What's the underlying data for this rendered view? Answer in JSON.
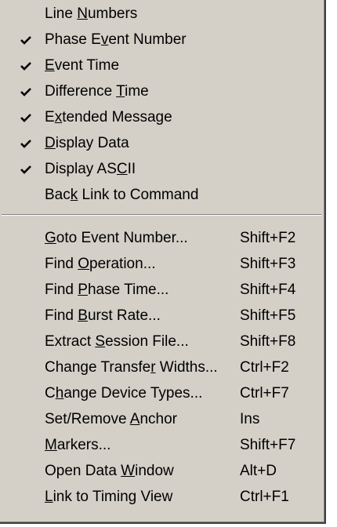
{
  "menu": {
    "view_items": [
      {
        "label_pre": "Line ",
        "accel": "N",
        "label_post": "umbers",
        "checked": false
      },
      {
        "label_pre": "Phase E",
        "accel": "v",
        "label_post": "ent Number",
        "checked": true
      },
      {
        "label_pre": "",
        "accel": "E",
        "label_post": "vent Time",
        "checked": true
      },
      {
        "label_pre": "Difference ",
        "accel": "T",
        "label_post": "ime",
        "checked": true
      },
      {
        "label_pre": "E",
        "accel": "x",
        "label_post": "tended Message",
        "checked": true
      },
      {
        "label_pre": "",
        "accel": "D",
        "label_post": "isplay Data",
        "checked": true
      },
      {
        "label_pre": "Display AS",
        "accel": "C",
        "label_post": "II",
        "checked": true
      },
      {
        "label_pre": "Bac",
        "accel": "k",
        "label_post": " Link to Command",
        "checked": false
      }
    ],
    "command_items": [
      {
        "label_pre": "",
        "accel": "G",
        "label_post": "oto Event Number...",
        "shortcut": "Shift+F2"
      },
      {
        "label_pre": "Find ",
        "accel": "O",
        "label_post": "peration...",
        "shortcut": "Shift+F3"
      },
      {
        "label_pre": "Find ",
        "accel": "P",
        "label_post": "hase Time...",
        "shortcut": "Shift+F4"
      },
      {
        "label_pre": "Find ",
        "accel": "B",
        "label_post": "urst Rate...",
        "shortcut": "Shift+F5"
      },
      {
        "label_pre": "Extract ",
        "accel": "S",
        "label_post": "ession File...",
        "shortcut": "Shift+F8"
      },
      {
        "label_pre": "Change Transfe",
        "accel": "r",
        "label_post": " Widths...",
        "shortcut": "Ctrl+F2"
      },
      {
        "label_pre": "C",
        "accel": "h",
        "label_post": "ange Device Types...",
        "shortcut": "Ctrl+F7"
      },
      {
        "label_pre": "Set/Remove ",
        "accel": "A",
        "label_post": "nchor",
        "shortcut": "Ins"
      },
      {
        "label_pre": "",
        "accel": "M",
        "label_post": "arkers...",
        "shortcut": "Shift+F7"
      },
      {
        "label_pre": "Open Data ",
        "accel": "W",
        "label_post": "indow",
        "shortcut": "Alt+D"
      },
      {
        "label_pre": "",
        "accel": "L",
        "label_post": "ink to Timing View",
        "shortcut": "Ctrl+F1"
      }
    ]
  }
}
